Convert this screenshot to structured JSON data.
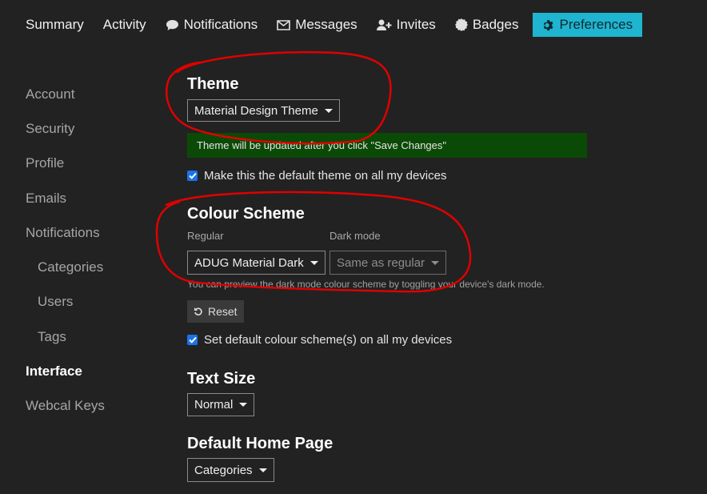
{
  "nav": {
    "tabs": [
      {
        "label": "Summary",
        "icon": ""
      },
      {
        "label": "Activity",
        "icon": ""
      },
      {
        "label": "Notifications",
        "icon": "comment-icon"
      },
      {
        "label": "Messages",
        "icon": "envelope-icon"
      },
      {
        "label": "Invites",
        "icon": "user-plus-icon"
      },
      {
        "label": "Badges",
        "icon": "certificate-icon"
      },
      {
        "label": "Preferences",
        "icon": "gear-icon"
      }
    ],
    "active_color": "#1fb5d0"
  },
  "sidebar": {
    "items": [
      {
        "label": "Account"
      },
      {
        "label": "Security"
      },
      {
        "label": "Profile"
      },
      {
        "label": "Emails"
      },
      {
        "label": "Notifications"
      },
      {
        "label": "Categories"
      },
      {
        "label": "Users"
      },
      {
        "label": "Tags"
      },
      {
        "label": "Interface"
      },
      {
        "label": "Webcal Keys"
      }
    ]
  },
  "theme": {
    "heading": "Theme",
    "selected": "Material Design Theme",
    "notice": "Theme will be updated after you click \"Save Changes\"",
    "default_checkbox": "Make this the default theme on all my devices"
  },
  "colour_scheme": {
    "heading": "Colour Scheme",
    "regular_label": "Regular",
    "regular_selected": "ADUG Material Dark",
    "dark_label": "Dark mode",
    "dark_selected": "Same as regular",
    "hint": "You can preview the dark mode colour scheme by toggling your device's dark mode.",
    "reset_label": "Reset",
    "default_checkbox": "Set default colour scheme(s) on all my devices"
  },
  "text_size": {
    "heading": "Text Size",
    "selected": "Normal"
  },
  "home_page": {
    "heading": "Default Home Page",
    "selected": "Categories"
  },
  "colors": {
    "background": "#222222",
    "notice_bg": "#0b4a06",
    "checkbox": "#1a73e8",
    "annotation": "#e00000"
  }
}
